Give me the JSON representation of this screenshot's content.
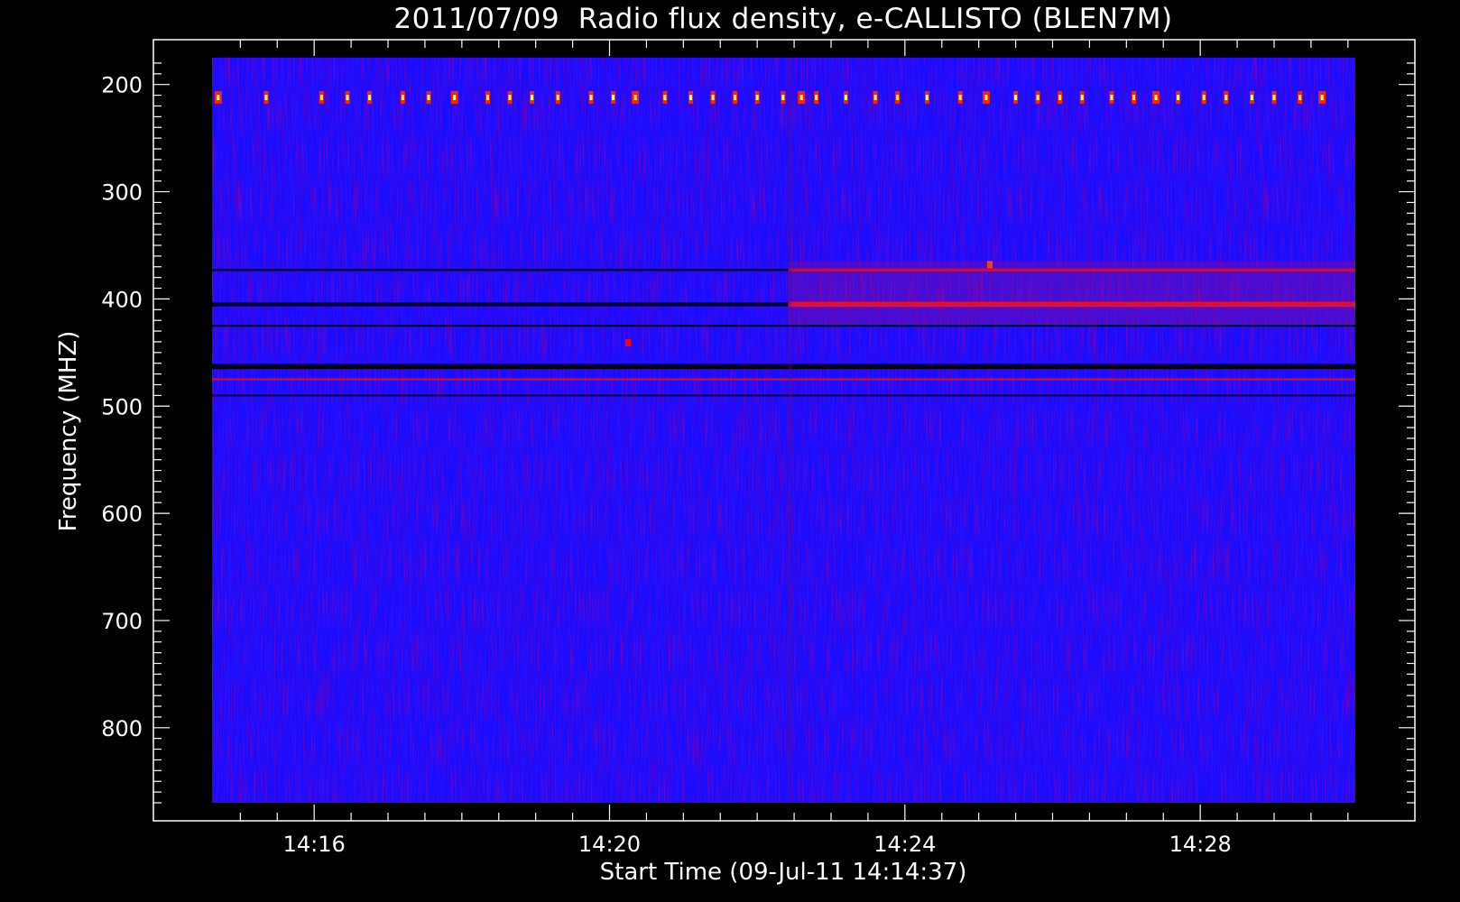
{
  "chart_data": {
    "type": "heatmap",
    "title": "2011/07/09  Radio flux density, e-CALLISTO (BLEN7M)",
    "xlabel": "Start Time (09-Jul-11 14:14:37)",
    "ylabel": "Frequency (MHZ)",
    "x_range_minutes": [
      14.617,
      30.1
    ],
    "y_range_mhz": [
      175,
      870
    ],
    "y_inverted": true,
    "x_ticks": [
      {
        "value": 16,
        "label": "14:16"
      },
      {
        "value": 20,
        "label": "14:20"
      },
      {
        "value": 24,
        "label": "14:24"
      },
      {
        "value": 28,
        "label": "14:28"
      }
    ],
    "y_ticks": [
      {
        "value": 200,
        "label": "200"
      },
      {
        "value": 300,
        "label": "300"
      },
      {
        "value": 400,
        "label": "400"
      },
      {
        "value": 500,
        "label": "500"
      },
      {
        "value": 600,
        "label": "600"
      },
      {
        "value": 700,
        "label": "700"
      },
      {
        "value": 800,
        "label": "800"
      }
    ],
    "colormap": [
      "#000000",
      "#1400ff",
      "#7a0060",
      "#ff0000",
      "#ffff66"
    ],
    "background_color": "#1a0dff",
    "features": {
      "periodic_bursts": {
        "freq_mhz": 212,
        "times_min": [
          14.7,
          15.35,
          16.1,
          16.45,
          16.75,
          17.2,
          17.55,
          17.9,
          18.35,
          18.65,
          18.95,
          19.3,
          19.75,
          20.05,
          20.35,
          20.75,
          21.1,
          21.4,
          21.7,
          22.0,
          22.35,
          22.6,
          22.8,
          23.2,
          23.6,
          23.9,
          24.3,
          24.75,
          25.1,
          25.5,
          25.8,
          26.1,
          26.4,
          26.8,
          27.1,
          27.4,
          27.7,
          28.05,
          28.35,
          28.7,
          29.0,
          29.35,
          29.65
        ],
        "color": "#ff2200",
        "peak_color": "#ffff70"
      },
      "bands": [
        {
          "freq_mhz": 405,
          "t_start": 22.42,
          "t_end": 30.1,
          "color": "#ff1010",
          "width_mhz": 5
        },
        {
          "freq_mhz": 373,
          "t_start": 22.42,
          "t_end": 30.1,
          "color": "#c0104a",
          "width_mhz": 3
        },
        {
          "freq_mhz": 405,
          "t_start": 14.617,
          "t_end": 22.42,
          "color": "#000022",
          "width_mhz": 4
        },
        {
          "freq_mhz": 373,
          "t_start": 14.617,
          "t_end": 22.42,
          "color": "#000033",
          "width_mhz": 2
        },
        {
          "freq_mhz": 425,
          "t_start": 14.617,
          "t_end": 30.1,
          "color": "#000030",
          "width_mhz": 2
        },
        {
          "freq_mhz": 463,
          "t_start": 14.617,
          "t_end": 30.1,
          "color": "#000010",
          "width_mhz": 5
        },
        {
          "freq_mhz": 475,
          "t_start": 14.617,
          "t_end": 30.1,
          "color": "#d0102a",
          "width_mhz": 2
        },
        {
          "freq_mhz": 490,
          "t_start": 14.617,
          "t_end": 30.1,
          "color": "#100040",
          "width_mhz": 2
        }
      ],
      "spots": [
        {
          "t_min": 20.25,
          "freq_mhz": 441,
          "color": "#ff0000"
        },
        {
          "t_min": 25.15,
          "freq_mhz": 368,
          "color": "#ff4010"
        }
      ]
    }
  }
}
